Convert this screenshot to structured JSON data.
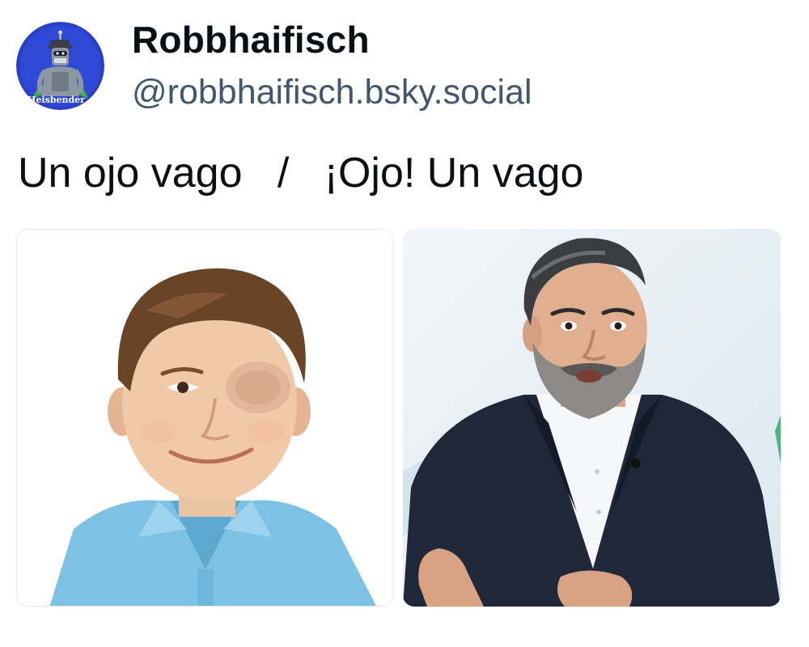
{
  "author": {
    "display_name": "Robbhaifisch",
    "handle": "@robbhaifisch.bsky.social",
    "avatar_icon": "robot-avatar-icon",
    "avatar_caption": "Heisbender",
    "avatar_bg": "#2a41c6"
  },
  "post": {
    "text": "Un ojo vago   /   ¡Ojo! Un vago"
  },
  "images": [
    {
      "subject": "boy-with-eye-patch-photo"
    },
    {
      "subject": "bearded-man-in-suit-photo"
    }
  ],
  "colors": {
    "name": "#0b0f14",
    "handle": "#42576c",
    "text": "#0b0f14"
  }
}
